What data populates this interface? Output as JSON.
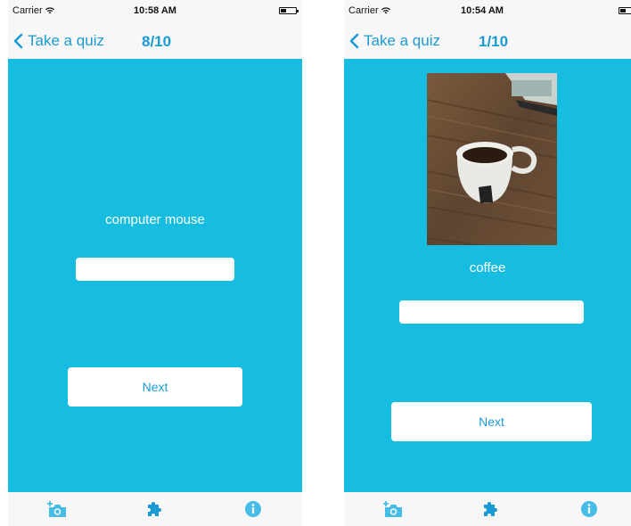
{
  "screens": [
    {
      "status": {
        "carrier": "Carrier",
        "time": "10:58 AM"
      },
      "nav": {
        "back_label": "Take a quiz",
        "title": "8/10"
      },
      "question": {
        "label": "computer mouse",
        "answer_value": ""
      },
      "next_label": "Next"
    },
    {
      "status": {
        "carrier": "Carrier",
        "time": "10:54 AM"
      },
      "nav": {
        "back_label": "Take a quiz",
        "title": "1/10"
      },
      "question": {
        "label": "coffee",
        "answer_value": ""
      },
      "next_label": "Next"
    }
  ],
  "tabbar": {
    "icons": [
      "add-photo-icon",
      "puzzle-icon",
      "info-icon"
    ]
  },
  "colors": {
    "accent": "#1a9bd3",
    "background": "#17bde1",
    "tab_icon": "#45bde6"
  }
}
